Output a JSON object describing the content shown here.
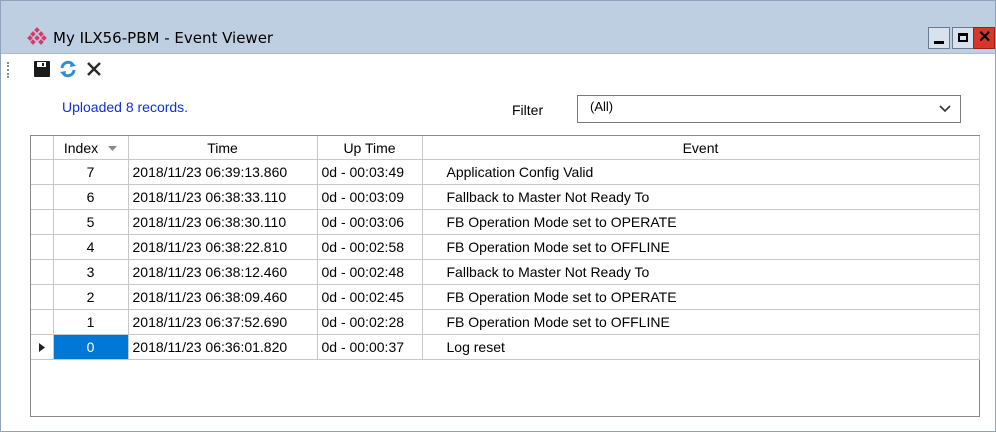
{
  "window": {
    "title": "My ILX56-PBM  - Event Viewer",
    "accent_color": "#bfcfe2",
    "close_color": "#d7372b"
  },
  "titlebar_buttons": {
    "minimize_icon": "minimize-icon",
    "maximize_icon": "maximize-icon",
    "close_icon": "close-icon",
    "close_glyph": "✕"
  },
  "toolbar": {
    "save_icon": "save-icon",
    "refresh_icon": "refresh-icon",
    "clear_icon": "clear-icon"
  },
  "status": {
    "text": "Uploaded 8 records.",
    "color": "#0e2fe0"
  },
  "filter": {
    "label": "Filter",
    "value": "(All)"
  },
  "table": {
    "columns": [
      {
        "label": "Index"
      },
      {
        "label": "Time"
      },
      {
        "label": "Up Time"
      },
      {
        "label": "Event"
      }
    ],
    "rows": [
      {
        "index": "7",
        "time": "2018/11/23 06:39:13.860",
        "uptime": "0d - 00:03:49",
        "event": "Application Config Valid"
      },
      {
        "index": "6",
        "time": "2018/11/23 06:38:33.110",
        "uptime": "0d - 00:03:09",
        "event": "Fallback to Master Not Ready To"
      },
      {
        "index": "5",
        "time": "2018/11/23 06:38:30.110",
        "uptime": "0d - 00:03:06",
        "event": "FB Operation Mode set to OPERATE"
      },
      {
        "index": "4",
        "time": "2018/11/23 06:38:22.810",
        "uptime": "0d - 00:02:58",
        "event": "FB Operation Mode set to OFFLINE"
      },
      {
        "index": "3",
        "time": "2018/11/23 06:38:12.460",
        "uptime": "0d - 00:02:48",
        "event": "Fallback to Master Not Ready To"
      },
      {
        "index": "2",
        "time": "2018/11/23 06:38:09.460",
        "uptime": "0d - 00:02:45",
        "event": "FB Operation Mode set to OPERATE"
      },
      {
        "index": "1",
        "time": "2018/11/23 06:37:52.690",
        "uptime": "0d - 00:02:28",
        "event": "FB Operation Mode set to OFFLINE"
      },
      {
        "index": "0",
        "time": "2018/11/23 06:36:01.820",
        "uptime": "0d - 00:00:37",
        "event": "Log reset",
        "selected": true
      }
    ],
    "selection_color": "#0078d7"
  }
}
